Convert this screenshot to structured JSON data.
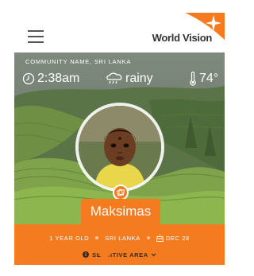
{
  "header": {
    "logo_text": "World Vision",
    "menu_icon": "hamburger-menu-icon"
  },
  "hero": {
    "community": "COMMUNITY NAME, SRI LANKA",
    "time": "2:38am",
    "condition": "rainy",
    "temperature": "74°"
  },
  "child": {
    "name": "Maksimas",
    "age": "1 YEAR OLD",
    "country": "SRI LANKA",
    "birthday": "DEC 28"
  },
  "sensitive": {
    "label": "SENSITIVE AREA"
  },
  "colors": {
    "accent": "#f47b20",
    "text_dark": "#333333",
    "white": "#ffffff"
  }
}
